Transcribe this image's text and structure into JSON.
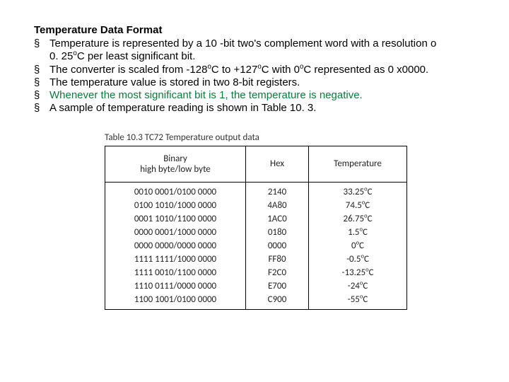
{
  "title": "Temperature Data Format",
  "bullets": {
    "b1a": "Temperature is represented by a 10 -bit two's complement word with a resolution o",
    "b1b": "0. 25",
    "b1c": "C per least significant bit.",
    "b2a": "The converter is scaled from -128",
    "b2b": "C to +127",
    "b2c": "C with 0",
    "b2d": "C represented as 0 x0000.",
    "b3": "The temperature value is stored in two 8-bit registers.",
    "b4": "Whenever the most significant bit is 1, the temperature is negative.",
    "b5": "A sample of temperature reading is shown in Table 10. 3."
  },
  "deg": "o",
  "table": {
    "caption": "Table 10.3 TC72 Temperature output data",
    "headers": {
      "bin1": "Binary",
      "bin2": "high byte/low byte",
      "hex": "Hex",
      "temp": "Temperature"
    },
    "rows": [
      {
        "bin": "0010 0001/0100 0000",
        "hex": "2140",
        "t": "33.25",
        "suffix": "C"
      },
      {
        "bin": "0100 1010/1000 0000",
        "hex": "4A80",
        "t": "74.5",
        "suffix": "C"
      },
      {
        "bin": "0001 1010/1100 0000",
        "hex": "1AC0",
        "t": "26.75",
        "suffix": "C"
      },
      {
        "bin": "0000 0001/1000 0000",
        "hex": "0180",
        "t": "1.5",
        "suffix": "C"
      },
      {
        "bin": "0000 0000/0000 0000",
        "hex": "0000",
        "t": "0",
        "suffix": "C"
      },
      {
        "bin": "1111 1111/1000 0000",
        "hex": "FF80",
        "t": "-0.5",
        "suffix": "C"
      },
      {
        "bin": "1111 0010/1100 0000",
        "hex": "F2C0",
        "t": "-13.25",
        "suffix": "C"
      },
      {
        "bin": "1110 0111/0000 0000",
        "hex": "E700",
        "t": "-24",
        "suffix": "C"
      },
      {
        "bin": "1100 1001/0100 0000",
        "hex": "C900",
        "t": "-55",
        "suffix": "C"
      }
    ]
  }
}
